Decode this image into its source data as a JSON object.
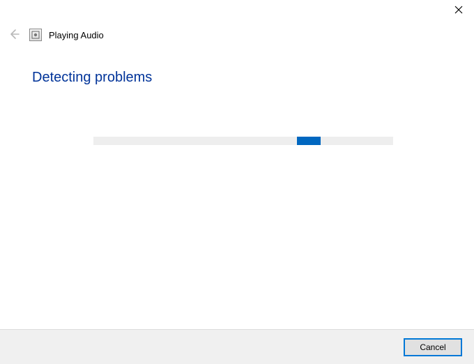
{
  "window": {
    "title": "Playing Audio"
  },
  "content": {
    "heading": "Detecting problems"
  },
  "footer": {
    "cancel_label": "Cancel"
  },
  "colors": {
    "heading": "#003399",
    "progress_fill": "#0067c0",
    "progress_track": "#eeeeee",
    "footer_bg": "#f0f0f0",
    "button_border": "#0078d7"
  },
  "progress": {
    "indeterminate": true,
    "chunk_offset_percent": 68
  }
}
